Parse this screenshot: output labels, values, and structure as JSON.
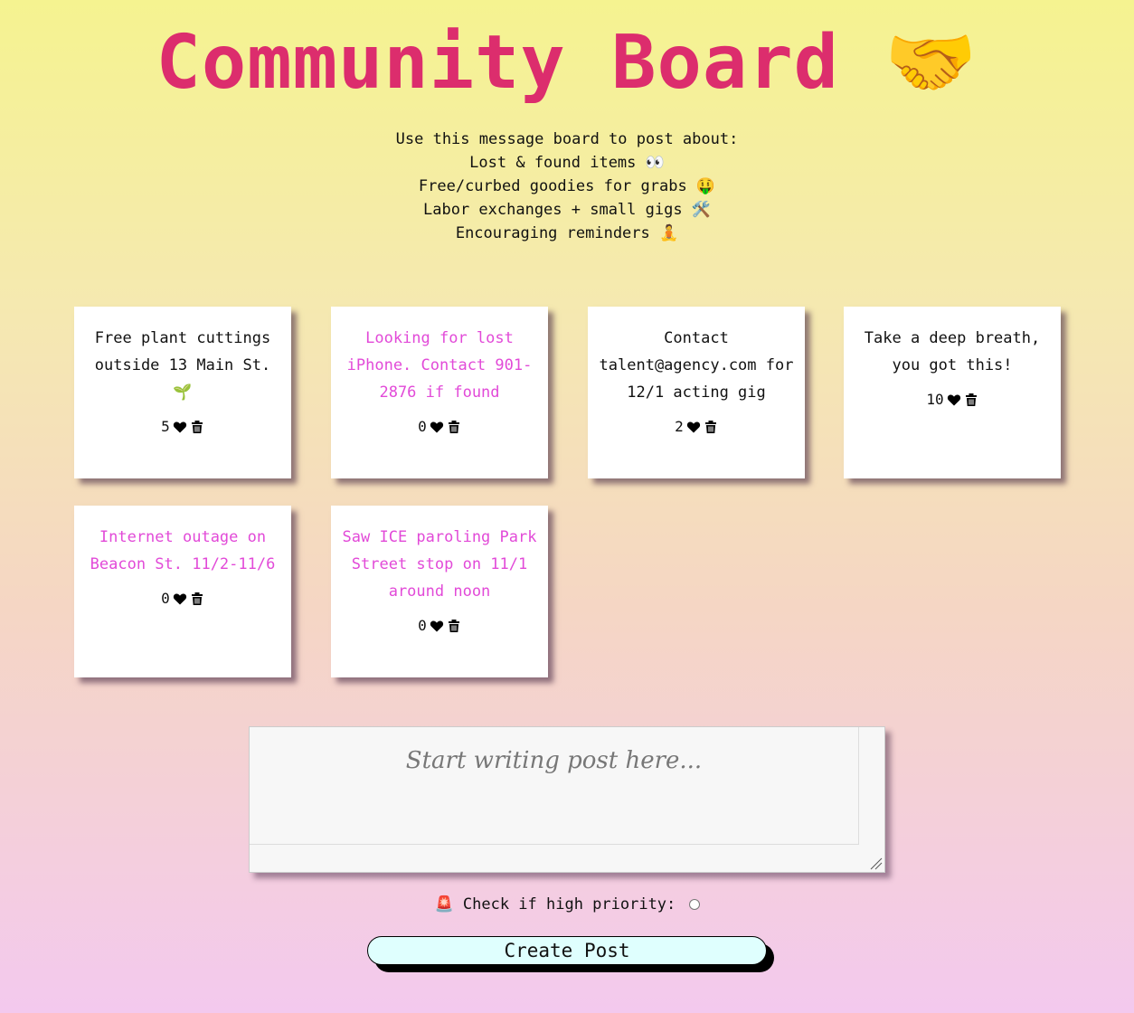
{
  "header": {
    "title": "Community Board",
    "title_emoji": "🤝"
  },
  "intro": {
    "lead": "Use this message board to post about:",
    "items": [
      "Lost & found items 👀",
      "Free/curbed goodies for grabs 🤑",
      "Labor exchanges + small gigs 🛠️",
      "Encouraging reminders 🧘"
    ]
  },
  "colors": {
    "title": "#dc2d6d",
    "priority_text": "#e24ad8",
    "button_bg": "#dffffe"
  },
  "posts": [
    {
      "text": "Free plant cuttings outside 13 Main St. 🌱",
      "likes": "5",
      "priority": false
    },
    {
      "text": "Looking for lost iPhone. Contact 901-2876 if found",
      "likes": "0",
      "priority": true
    },
    {
      "text": "Contact talent@agency.com for 12/1 acting gig",
      "likes": "2",
      "priority": false
    },
    {
      "text": "Take a deep breath, you got this!",
      "likes": "10",
      "priority": false
    },
    {
      "text": "Internet outage on Beacon St. 11/2-11/6",
      "likes": "0",
      "priority": true
    },
    {
      "text": "Saw ICE paroling Park Street stop on 11/1 around noon",
      "likes": "0",
      "priority": true
    }
  ],
  "composer": {
    "placeholder": "Start writing post here..."
  },
  "priority": {
    "icon": "🚨",
    "label": "Check if high priority:"
  },
  "submit": {
    "label": "Create Post"
  }
}
